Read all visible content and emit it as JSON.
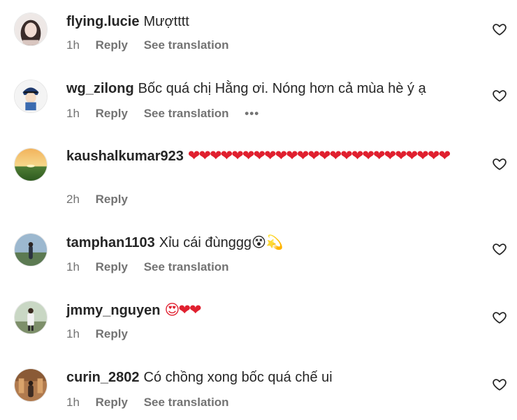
{
  "colors": {
    "text": "#262626",
    "secondary": "#737373",
    "heart_emoji": "#e0202f"
  },
  "comments": [
    {
      "username": "flying.lucie",
      "text": "Mượtttt",
      "time": "1h",
      "reply": "Reply",
      "translate": "See translation",
      "like_icon": "heart-outline-icon"
    },
    {
      "username": "wg_zilong",
      "text": "Bốc quá chị Hằng ơi. Nóng hơn cả mùa hè ý ạ",
      "time": "1h",
      "reply": "Reply",
      "translate": "See translation",
      "more": "•••",
      "like_icon": "heart-outline-icon"
    },
    {
      "username": "kaushalkumar923",
      "text": "❤❤❤❤❤❤❤❤❤❤❤❤❤❤❤❤❤❤❤❤❤❤❤❤",
      "time": "2h",
      "reply": "Reply",
      "like_icon": "heart-outline-icon"
    },
    {
      "username": "tamphan1103",
      "text": "Xỉu cái đùnggg",
      "emoji": "😵💫",
      "time": "1h",
      "reply": "Reply",
      "translate": "See translation",
      "like_icon": "heart-outline-icon"
    },
    {
      "username": "jmmy_nguyen",
      "text": "😍❤❤",
      "time": "1h",
      "reply": "Reply",
      "like_icon": "heart-outline-icon"
    },
    {
      "username": "curin_2802",
      "text": "Có chồng xong bốc quá chế ui",
      "time": "1h",
      "reply": "Reply",
      "translate": "See translation",
      "like_icon": "heart-outline-icon"
    }
  ]
}
